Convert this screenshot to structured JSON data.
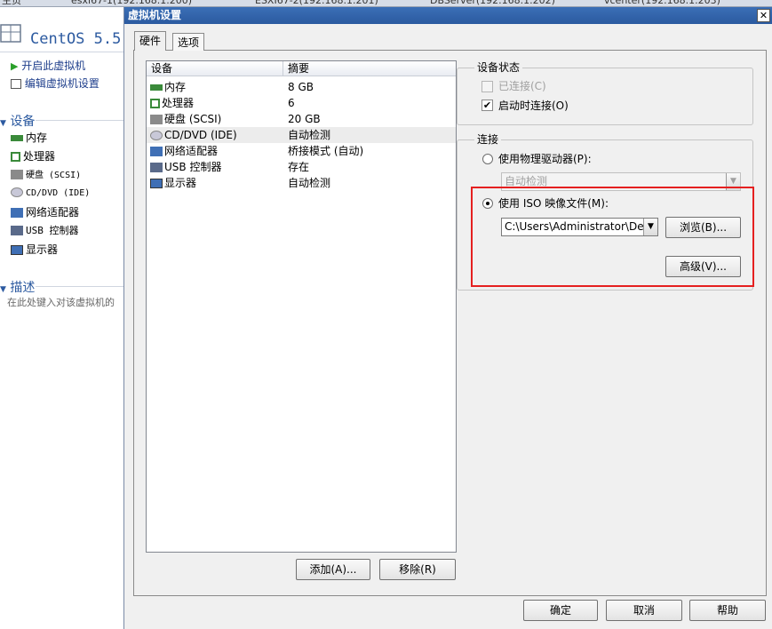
{
  "background_tabs": [
    "主页",
    "esxi67-1(192.168.1.200)",
    "ESXI67-2(192.168.1.201)",
    "DBServer(192.168.1.202)",
    "vcenter(192.168.1.203)"
  ],
  "left_panel": {
    "vm_title": "CentOS 5.5",
    "commands": {
      "power_on": "开启此虚拟机",
      "edit_settings": "编辑虚拟机设置"
    },
    "devices_header": "设备",
    "devices": [
      "内存",
      "处理器",
      "硬盘 (SCSI)",
      "CD/DVD (IDE)",
      "网络适配器",
      "USB 控制器",
      "显示器"
    ],
    "description_header": "描述",
    "description_placeholder": "在此处键入对该虚拟机的"
  },
  "dialog": {
    "title": "虚拟机设置",
    "close_glyph": "✕",
    "tabs": [
      "硬件",
      "选项"
    ],
    "device_list": {
      "headers": {
        "device": "设备",
        "summary": "摘要"
      },
      "rows": [
        {
          "device": "内存",
          "summary": "8 GB",
          "icon": "memory-icon"
        },
        {
          "device": "处理器",
          "summary": "6",
          "icon": "cpu-icon"
        },
        {
          "device": "硬盘 (SCSI)",
          "summary": "20 GB",
          "icon": "hdd-icon"
        },
        {
          "device": "CD/DVD (IDE)",
          "summary": "自动检测",
          "icon": "cd-icon"
        },
        {
          "device": "网络适配器",
          "summary": "桥接模式 (自动)",
          "icon": "network-icon"
        },
        {
          "device": "USB 控制器",
          "summary": "存在",
          "icon": "usb-icon"
        },
        {
          "device": "显示器",
          "summary": "自动检测",
          "icon": "monitor-icon"
        }
      ],
      "selected_index": 3
    },
    "add_button": "添加(A)...",
    "remove_button": "移除(R)",
    "device_status": {
      "label": "设备状态",
      "connected": {
        "label": "已连接(C)",
        "checked": false,
        "disabled": true
      },
      "connect_at_power_on": {
        "label": "启动时连接(O)",
        "checked": true
      }
    },
    "connection": {
      "label": "连接",
      "physical_drive": {
        "label": "使用物理驱动器(P):",
        "selected": false,
        "value": "自动检测"
      },
      "iso_image": {
        "label": "使用 ISO 映像文件(M):",
        "selected": true,
        "path": "C:\\Users\\Administrator\\Desk"
      },
      "browse_button": "浏览(B)...",
      "advanced_button": "高级(V)..."
    },
    "ok_button": "确定",
    "cancel_button": "取消",
    "help_button": "帮助",
    "highlight_color": "#e52020"
  }
}
